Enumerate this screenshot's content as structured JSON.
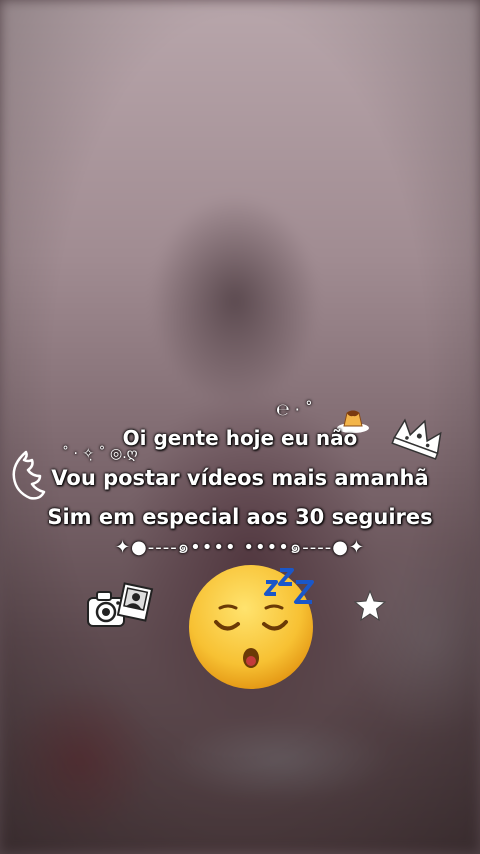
{
  "overlay": {
    "lines": [
      "Oi gente hoje eu não",
      "Vou postar vídeos mais amanhã",
      "Sim em especial aos 30 seguires"
    ],
    "divider": "✦●----๑••••  ••••๑----●✦"
  },
  "stickers": [
    "wing-icon",
    "crown-icon",
    "pudding-icon",
    "camera-icon",
    "photo-icon",
    "star-icon",
    "sleeping-face-emoji",
    "zzz-icon"
  ],
  "colors": {
    "text": "#ffffff",
    "emoji": "#f7c133",
    "zzz": "#1a57c9"
  }
}
